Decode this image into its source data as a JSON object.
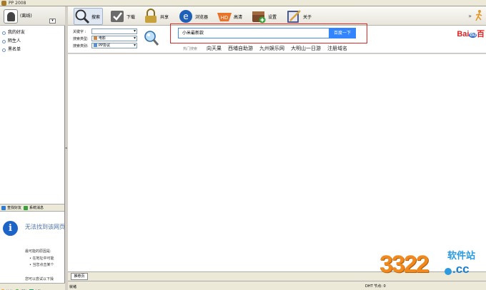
{
  "window": {
    "title": "PP 2008"
  },
  "user": {
    "status": "(离线)"
  },
  "sidebar": {
    "tree": [
      {
        "label": "我的好友"
      },
      {
        "label": "陌生人"
      },
      {
        "label": "黑名单"
      }
    ],
    "buttons": [
      {
        "label": "查找好友"
      },
      {
        "label": "系统消息"
      }
    ],
    "error": {
      "title": "无法找到该网页",
      "causes_heading": "最可能的原因是:",
      "cause1": "• 在地址中可能",
      "cause2": "• 当您点击某个",
      "try_text": "您可以尝试以下操"
    },
    "footer": [
      {
        "label": "菜单"
      },
      {
        "label": "帮助"
      },
      {
        "label": "完整"
      }
    ]
  },
  "toolbar": {
    "buttons": [
      {
        "label": "搜索",
        "icon": "magnifier-icon"
      },
      {
        "label": "下载",
        "icon": "download-check-icon"
      },
      {
        "label": "共享",
        "icon": "lock-share-icon"
      },
      {
        "label": "浏览器",
        "icon": "ie-browser-icon"
      },
      {
        "label": "高清",
        "icon": "hd-video-icon"
      },
      {
        "label": "设置",
        "icon": "settings-box-icon"
      },
      {
        "label": "关于",
        "icon": "notebook-pen-icon"
      }
    ],
    "more": "»"
  },
  "search": {
    "keyword_label": "关键字 :",
    "keyword_value": "",
    "type_label": "搜索类型:",
    "type_value": "电影",
    "category_label": "搜索类别:",
    "category_value": "PP协议"
  },
  "baidu": {
    "input_value": "小米最新款",
    "button_label": "百度一下",
    "hot_label": "热门搜索",
    "hot_keywords": [
      "向天果",
      "西埔自助游",
      "九州娱乐网",
      "大明山一日游",
      "注册域名"
    ],
    "logo_left": "Bai",
    "logo_mid": "du",
    "logo_right": "百"
  },
  "tabs": [
    {
      "label": "推荐页"
    }
  ],
  "status": {
    "ready": "就绪",
    "dht": "DHT 节点: 0"
  },
  "watermark": {
    "number": "3322",
    "site": "软件站",
    "cc": ".cc"
  },
  "colors": {
    "accent": "#3385ff",
    "highlight_box": "#e02828",
    "watermark_orange": "#f18a1e",
    "watermark_blue": "#2b9adf"
  }
}
